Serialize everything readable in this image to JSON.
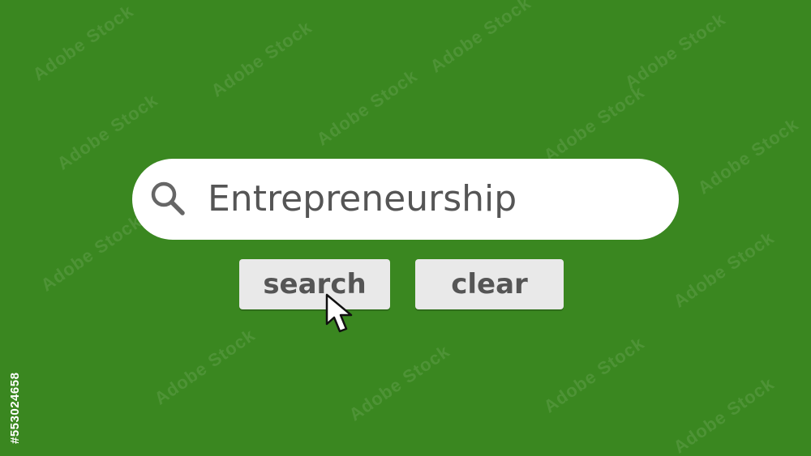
{
  "page": {
    "background_color": "#3a8720",
    "side_id": "#553024658",
    "watermark": "Adobe Stock"
  },
  "search": {
    "query": "Entrepreneurship",
    "icon": "search-icon"
  },
  "buttons": {
    "search_label": "search",
    "clear_label": "clear"
  },
  "cursor": {
    "icon": "arrow-cursor-icon"
  }
}
